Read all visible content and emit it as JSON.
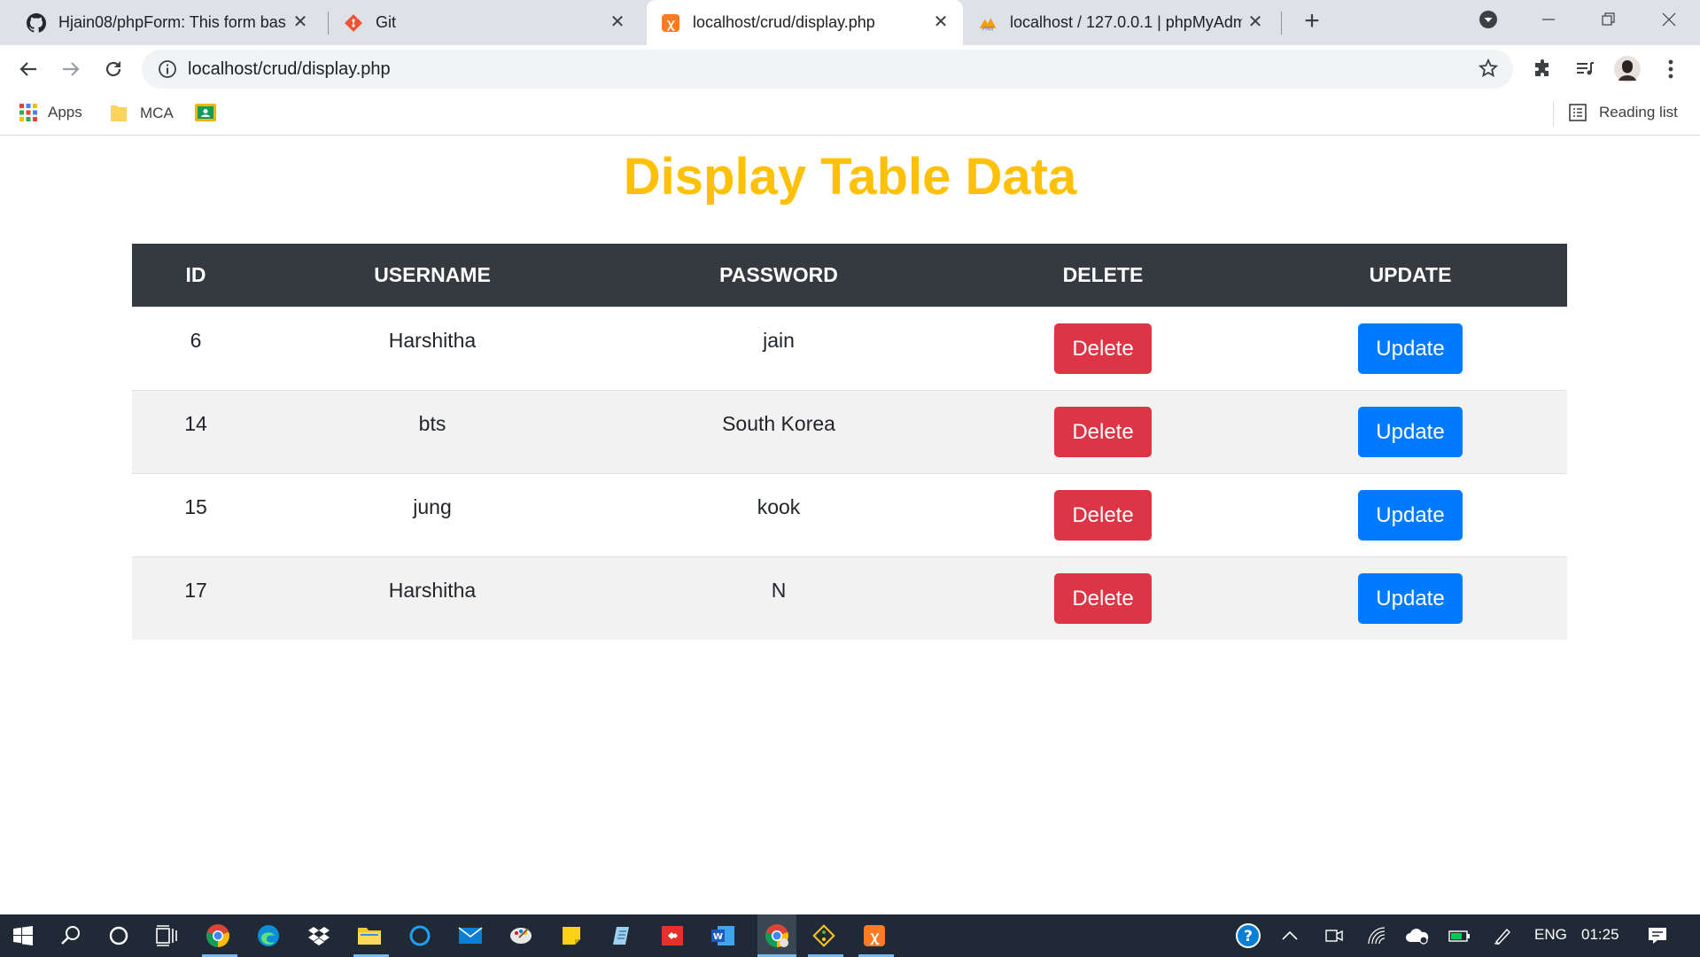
{
  "browser": {
    "tabs": [
      {
        "title": "Hjain08/phpForm: This form basi",
        "icon": "github-icon"
      },
      {
        "title": "Git",
        "icon": "git-icon"
      },
      {
        "title": "localhost/crud/display.php",
        "icon": "xampp-icon"
      },
      {
        "title": "localhost / 127.0.0.1 | phpMyAdm",
        "icon": "phpmyadmin-icon"
      }
    ],
    "url": "localhost/crud/display.php",
    "bookmarks": {
      "apps": "Apps",
      "mca": "MCA",
      "reading_list": "Reading list"
    }
  },
  "page": {
    "heading": "Display Table Data",
    "columns": [
      "ID",
      "USERNAME",
      "PASSWORD",
      "DELETE",
      "UPDATE"
    ],
    "rows": [
      {
        "id": "6",
        "username": "Harshitha",
        "password": "jain"
      },
      {
        "id": "14",
        "username": "bts",
        "password": "South Korea"
      },
      {
        "id": "15",
        "username": "jung",
        "password": "kook"
      },
      {
        "id": "17",
        "username": "Harshitha",
        "password": "N"
      }
    ],
    "delete_label": "Delete",
    "update_label": "Update",
    "colors": {
      "heading": "#ffc107",
      "header_bg": "#343a40",
      "delete": "#dc3545",
      "update": "#007bff"
    }
  },
  "taskbar": {
    "language": "ENG",
    "time": "01:25"
  }
}
